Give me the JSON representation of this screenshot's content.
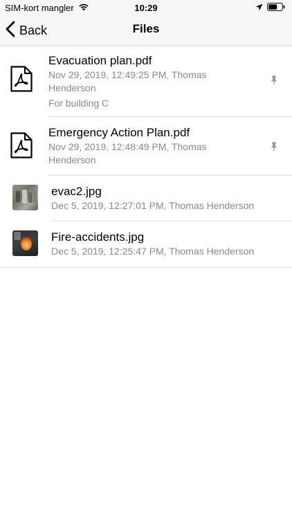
{
  "status_bar": {
    "carrier": "SIM-kort mangler",
    "time": "10:29"
  },
  "nav": {
    "back_label": "Back",
    "title": "Files"
  },
  "files": [
    {
      "name": "Evacuation plan.pdf",
      "meta": "Nov 29, 2019, 12:49:25 PM, Thomas Henderson",
      "meta_line1": "Nov 29, 2019, 12:49:25 PM, Thomas",
      "meta_line2": "Henderson",
      "note": "For building C",
      "icon": "pdf-document-icon",
      "pinned": true
    },
    {
      "name": "Emergency Action Plan.pdf",
      "meta": "Nov 29, 2019, 12:48:49 PM, Thomas Henderson",
      "meta_line1": "Nov 29, 2019, 12:48:49 PM, Thomas",
      "meta_line2": "Henderson",
      "icon": "pdf-document-icon",
      "pinned": true
    },
    {
      "name": "evac2.jpg",
      "meta": "Dec 5, 2019, 12:27:01 PM, Thomas Henderson",
      "icon": "image-thumbnail"
    },
    {
      "name": "Fire-accidents.jpg",
      "meta": "Dec 5, 2019, 12:25:47 PM, Thomas Henderson",
      "icon": "image-thumbnail"
    }
  ],
  "colors": {
    "bar_background": "#f7f7f7",
    "secondary_text": "#8a8a8a",
    "separator": "#e3e3e3"
  }
}
